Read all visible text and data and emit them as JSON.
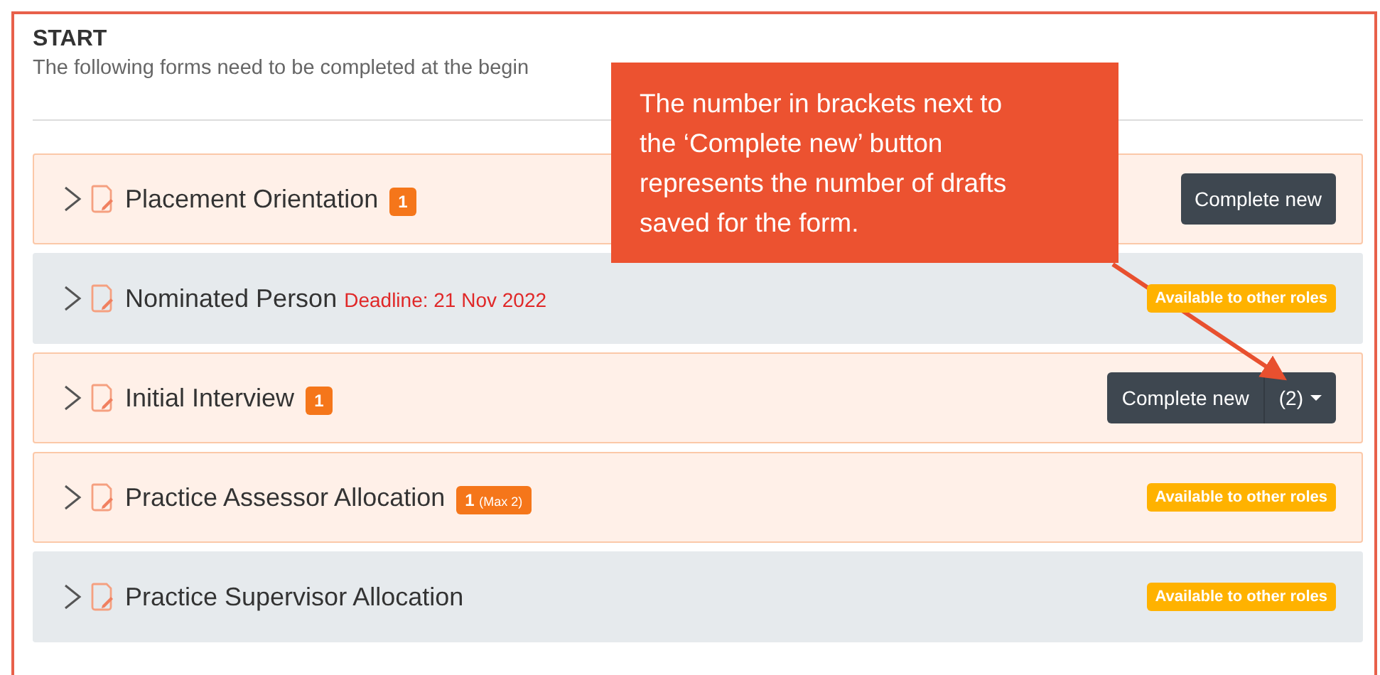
{
  "section": {
    "title": "START",
    "subtitle": "The following forms need to be completed at the begin"
  },
  "forms": [
    {
      "title": "Placement Orientation",
      "highlighted": true,
      "count": "1",
      "action": {
        "kind": "button",
        "label": "Complete new"
      }
    },
    {
      "title": "Nominated Person",
      "highlighted": false,
      "deadline": "Deadline: 21 Nov 2022",
      "action": {
        "kind": "tag",
        "label": "Available to other roles"
      }
    },
    {
      "title": "Initial Interview",
      "highlighted": true,
      "count": "1",
      "action": {
        "kind": "split-button",
        "label": "Complete new",
        "drafts": "(2)"
      }
    },
    {
      "title": "Practice Assessor Allocation",
      "highlighted": true,
      "count": "1",
      "count_note": "(Max 2)",
      "action": {
        "kind": "tag",
        "label": "Available to other roles"
      }
    },
    {
      "title": "Practice Supervisor Allocation",
      "highlighted": false,
      "action": {
        "kind": "tag",
        "label": "Available to other roles"
      }
    }
  ],
  "callout": {
    "text": "The number in brackets next to the ‘Complete new’ button represents the number of drafts saved for the form."
  }
}
